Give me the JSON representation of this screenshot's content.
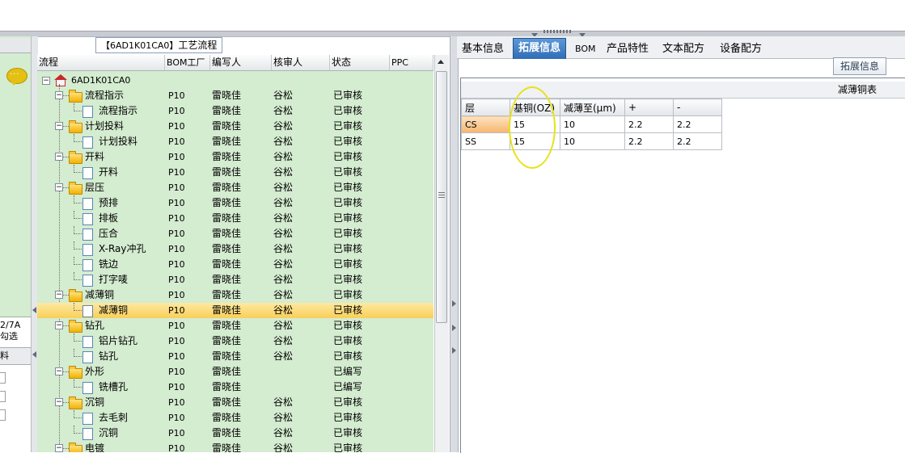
{
  "tree_panel": {
    "title_code": "【6AD1K01CA0】",
    "title_text": "工艺流程",
    "columns": [
      "流程",
      "BOM工厂",
      "编写人",
      "核审人",
      "状态",
      "PPC"
    ],
    "root_label": "6AD1K01CA0",
    "rows": [
      {
        "level": 1,
        "type": "folder",
        "name": "流程指示",
        "factory": "P10",
        "writer": "雷晓佳",
        "reviewer": "谷松",
        "status": "已审核"
      },
      {
        "level": 2,
        "type": "doc",
        "name": "流程指示",
        "factory": "P10",
        "writer": "雷晓佳",
        "reviewer": "谷松",
        "status": "已审核"
      },
      {
        "level": 1,
        "type": "folder",
        "name": "计划投料",
        "factory": "P10",
        "writer": "雷晓佳",
        "reviewer": "谷松",
        "status": "已审核"
      },
      {
        "level": 2,
        "type": "doc",
        "name": "计划投料",
        "factory": "P10",
        "writer": "雷晓佳",
        "reviewer": "谷松",
        "status": "已审核"
      },
      {
        "level": 1,
        "type": "folder",
        "name": "开料",
        "factory": "P10",
        "writer": "雷晓佳",
        "reviewer": "谷松",
        "status": "已审核"
      },
      {
        "level": 2,
        "type": "doc",
        "name": "开料",
        "factory": "P10",
        "writer": "雷晓佳",
        "reviewer": "谷松",
        "status": "已审核"
      },
      {
        "level": 1,
        "type": "folder",
        "name": "层压",
        "factory": "P10",
        "writer": "雷晓佳",
        "reviewer": "谷松",
        "status": "已审核"
      },
      {
        "level": 2,
        "type": "doc",
        "name": "预排",
        "factory": "P10",
        "writer": "雷晓佳",
        "reviewer": "谷松",
        "status": "已审核"
      },
      {
        "level": 2,
        "type": "doc",
        "name": "排板",
        "factory": "P10",
        "writer": "雷晓佳",
        "reviewer": "谷松",
        "status": "已审核"
      },
      {
        "level": 2,
        "type": "doc",
        "name": "压合",
        "factory": "P10",
        "writer": "雷晓佳",
        "reviewer": "谷松",
        "status": "已审核"
      },
      {
        "level": 2,
        "type": "doc",
        "name": "X-Ray冲孔",
        "factory": "P10",
        "writer": "雷晓佳",
        "reviewer": "谷松",
        "status": "已审核"
      },
      {
        "level": 2,
        "type": "doc",
        "name": "铣边",
        "factory": "P10",
        "writer": "雷晓佳",
        "reviewer": "谷松",
        "status": "已审核"
      },
      {
        "level": 2,
        "type": "doc",
        "name": "打字唛",
        "factory": "P10",
        "writer": "雷晓佳",
        "reviewer": "谷松",
        "status": "已审核"
      },
      {
        "level": 1,
        "type": "folder",
        "name": "减薄铜",
        "factory": "P10",
        "writer": "雷晓佳",
        "reviewer": "谷松",
        "status": "已审核"
      },
      {
        "level": 2,
        "type": "doc",
        "name": "减薄铜",
        "factory": "P10",
        "writer": "雷晓佳",
        "reviewer": "谷松",
        "status": "已审核",
        "selected": true
      },
      {
        "level": 1,
        "type": "folder",
        "name": "钻孔",
        "factory": "P10",
        "writer": "雷晓佳",
        "reviewer": "谷松",
        "status": "已审核"
      },
      {
        "level": 2,
        "type": "doc",
        "name": "铝片钻孔",
        "factory": "P10",
        "writer": "雷晓佳",
        "reviewer": "谷松",
        "status": "已审核"
      },
      {
        "level": 2,
        "type": "doc",
        "name": "钻孔",
        "factory": "P10",
        "writer": "雷晓佳",
        "reviewer": "谷松",
        "status": "已审核"
      },
      {
        "level": 1,
        "type": "folder",
        "name": "外形",
        "factory": "P10",
        "writer": "雷晓佳",
        "reviewer": "",
        "status": "已编写"
      },
      {
        "level": 2,
        "type": "doc",
        "name": "铣槽孔",
        "factory": "P10",
        "writer": "雷晓佳",
        "reviewer": "",
        "status": "已编写"
      },
      {
        "level": 1,
        "type": "folder",
        "name": "沉铜",
        "factory": "P10",
        "writer": "雷晓佳",
        "reviewer": "谷松",
        "status": "已审核"
      },
      {
        "level": 2,
        "type": "doc",
        "name": "去毛刺",
        "factory": "P10",
        "writer": "雷晓佳",
        "reviewer": "谷松",
        "status": "已审核"
      },
      {
        "level": 2,
        "type": "doc",
        "name": "沉铜",
        "factory": "P10",
        "writer": "雷晓佳",
        "reviewer": "谷松",
        "status": "已审核"
      },
      {
        "level": 1,
        "type": "folder",
        "name": "电镀",
        "factory": "P10",
        "writer": "雷晓佳",
        "reviewer": "谷松",
        "status": "已审核"
      }
    ]
  },
  "left_panel": {
    "line1": "2/7A",
    "line2": "勾选",
    "header": "料"
  },
  "tabs": [
    {
      "label": "基本信息",
      "active": false
    },
    {
      "label": "拓展信息",
      "active": true
    },
    {
      "label": "BOM",
      "active": false
    },
    {
      "label": "产品特性",
      "active": false
    },
    {
      "label": "文本配方",
      "active": false
    },
    {
      "label": "设备配方",
      "active": false
    }
  ],
  "ext_button": "拓展信息",
  "grid": {
    "caption": "减薄铜表",
    "columns": [
      "层",
      "基铜(OZ)",
      "减薄至(μm)",
      "+",
      "-"
    ],
    "rows": [
      [
        "CS",
        "15",
        "10",
        "2.2",
        "2.2"
      ],
      [
        "SS",
        "15",
        "10",
        "2.2",
        "2.2"
      ]
    ]
  },
  "colors": {
    "tree_background": "#d4ecd0",
    "selected_row": "#f9cf59",
    "active_tab": "#3a78c0",
    "highlight_ellipse": "#e7e21a"
  }
}
